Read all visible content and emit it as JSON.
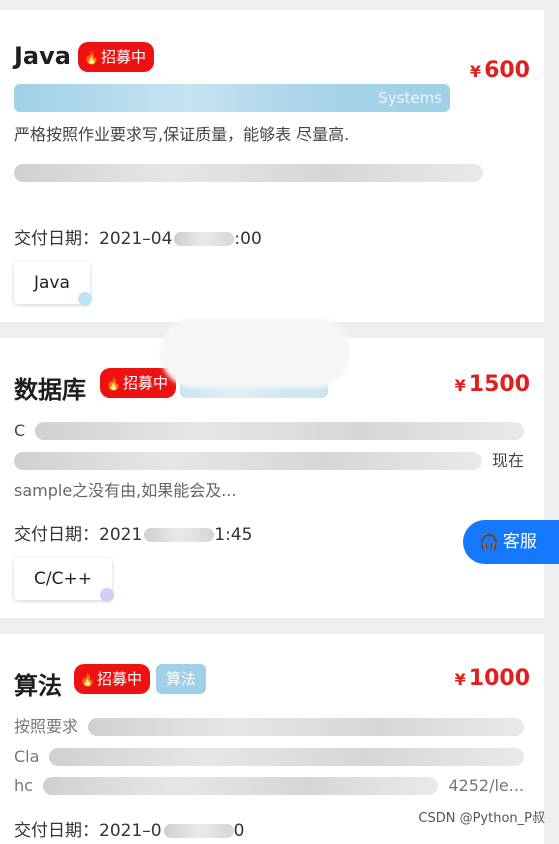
{
  "cards": [
    {
      "title": "Java",
      "status_badge": "招募中",
      "price_currency": "¥",
      "price": "600",
      "category_partial": "Systems",
      "description": "严格按照作业要求写,保证质量，能够表 尽量高.",
      "delivery_label": "交付日期：2021–04",
      "delivery_tail": ":00",
      "skill": "Java"
    },
    {
      "title": "数据库",
      "status_badge": "招募中",
      "price_currency": "¥",
      "price": "1500",
      "description_line1": "C",
      "description_line2_tail": "现在",
      "description_line3": "sample之没有由,如果能会及...",
      "delivery_label": "交付日期：2021",
      "delivery_tail": "1:45",
      "skill": "C/C++"
    },
    {
      "title": "算法",
      "status_badge": "招募中",
      "category": "算法",
      "price_currency": "¥",
      "price": "1000",
      "description_line1": "按照要求",
      "description_line2": "Cla",
      "description_line3": "hc",
      "description_line3_tail": "4252/le...",
      "delivery_label": "交付日期：2021–0",
      "delivery_tail": "0"
    }
  ],
  "service_button": "客服",
  "watermark": "CSDN @Python_P叔",
  "colors": {
    "badge_red": "#ee1111",
    "price_red": "#e0201e",
    "tag_blue": "#9fd0e6",
    "service_blue": "#1677ff"
  }
}
